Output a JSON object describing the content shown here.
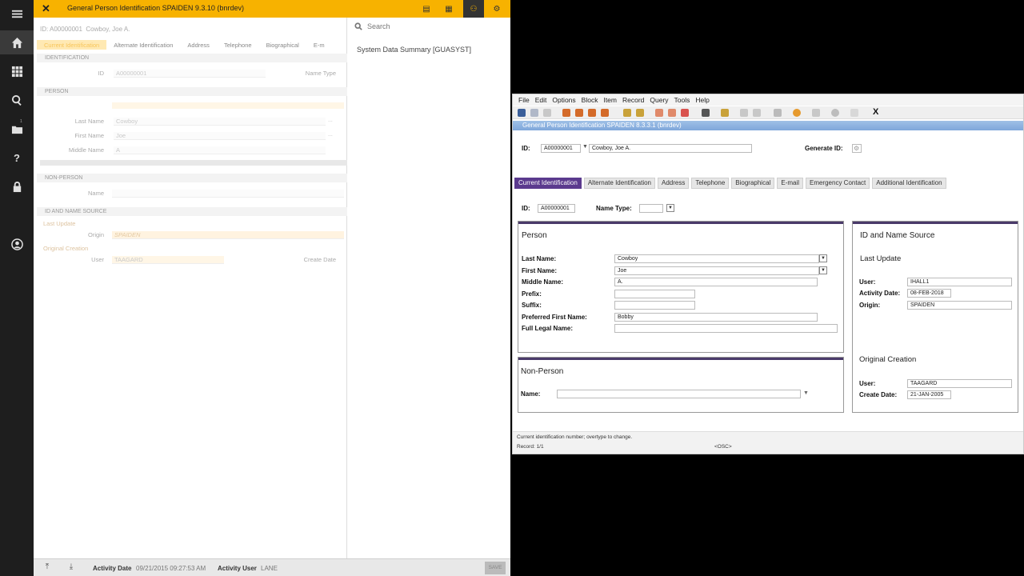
{
  "nav": {
    "items": [
      "menu",
      "home",
      "apps",
      "search",
      "recent",
      "help",
      "lock",
      "user"
    ],
    "recent_badge": "1"
  },
  "b9": {
    "title": "General Person Identification SPAIDEN 9.3.10 (bnrdev)",
    "key": {
      "id_label": "ID:",
      "id_value": "A00000001",
      "name": "Cowboy, Joe A."
    },
    "tabs": [
      "Current Identification",
      "Alternate Identification",
      "Address",
      "Telephone",
      "Biographical",
      "E-m"
    ],
    "sections": {
      "identification": "IDENTIFICATION",
      "person": "PERSON",
      "non_person": "NON-PERSON",
      "source": "ID AND NAME SOURCE"
    },
    "fields": {
      "id_label": "ID",
      "id_value": "A00000001",
      "name_type_label": "Name Type",
      "last_name_label": "Last Name",
      "last_name": "Cowboy",
      "first_name_label": "First Name",
      "first_name": "Joe",
      "middle_name_label": "Middle Name",
      "middle_name": "A",
      "np_name_label": "Name",
      "last_update_label": "Last Update",
      "origin_label": "Origin",
      "origin": "SPAIDEN",
      "orig_creation_label": "Original Creation",
      "user_label": "User",
      "user": "TAAGARD",
      "create_date_label": "Create Date",
      "ellipsis": "..."
    },
    "side": {
      "search_placeholder": "Search",
      "item": "System Data Summary [GUASYST]"
    },
    "footer": {
      "activity_date_label": "Activity Date",
      "activity_date": "09/21/2015 09:27:53 AM",
      "activity_user_label": "Activity User",
      "activity_user": "LANE",
      "save_label": "SAVE"
    }
  },
  "b8": {
    "menu": [
      "File",
      "Edit",
      "Options",
      "Block",
      "Item",
      "Record",
      "Query",
      "Tools",
      "Help"
    ],
    "close_x": "X",
    "window_title": "General Person Identification  SPAIDEN  8.3.3.1  (bnrdev)",
    "key": {
      "id_label": "ID:",
      "id_value": "A00000001",
      "name": "Cowboy, Joe A.",
      "generate_label": "Generate ID:",
      "generate_icon": "gear-icon"
    },
    "tabs": [
      "Current Identification",
      "Alternate Identification",
      "Address",
      "Telephone",
      "Biographical",
      "E-mail",
      "Emergency Contact",
      "Additional Identification"
    ],
    "id_row": {
      "id_label": "ID:",
      "id_value": "A00000001",
      "name_type_label": "Name Type:"
    },
    "person": {
      "title": "Person",
      "last_name_label": "Last Name:",
      "last_name": "Cowboy",
      "first_name_label": "First Name:",
      "first_name": "Joe",
      "middle_name_label": "Middle Name:",
      "middle_name": "A.",
      "prefix_label": "Prefix:",
      "suffix_label": "Suffix:",
      "pref_first_label": "Preferred First Name:",
      "pref_first": "Bobby",
      "full_legal_label": "Full Legal Name:"
    },
    "non_person": {
      "title": "Non-Person",
      "name_label": "Name:"
    },
    "source": {
      "title": "ID and Name Source",
      "last_update": "Last Update",
      "user_label": "User:",
      "user": "IHALL1",
      "activity_date_label": "Activity Date:",
      "activity_date": "08-FEB-2018",
      "origin_label": "Origin:",
      "origin": "SPAIDEN",
      "orig_creation": "Original Creation",
      "oc_user_label": "User:",
      "oc_user": "TAAGARD",
      "create_date_label": "Create Date:",
      "create_date": "21-JAN-2005"
    },
    "status": {
      "message": "Current identification number; overtype to change.",
      "record": "Record: 1/1",
      "osc": "<OSC>"
    }
  }
}
